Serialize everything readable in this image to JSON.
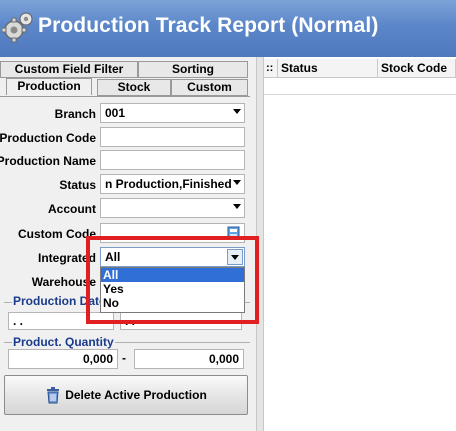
{
  "window": {
    "title": "Production Track Report (Normal)"
  },
  "tabs": {
    "row1": [
      "Custom Field Filter",
      "Sorting"
    ],
    "row2": [
      "Production",
      "Stock",
      "Custom"
    ]
  },
  "form": {
    "branch": {
      "label": "Branch",
      "value": "001"
    },
    "production_code": {
      "label": "Production Code",
      "value": ""
    },
    "production_name": {
      "label": "Production Name",
      "value": ""
    },
    "status": {
      "label": "Status",
      "value": "n Production,Finished"
    },
    "account": {
      "label": "Account",
      "value": ""
    },
    "custom_code": {
      "label": "Custom Code",
      "value": ""
    },
    "integrated": {
      "label": "Integrated",
      "value": "All"
    },
    "warehouse": {
      "label": "Warehouse",
      "value": ""
    }
  },
  "production_date": {
    "label": "Production Date",
    "from": ". .",
    "to": ". ."
  },
  "product_quantity": {
    "label": "Product. Quantity",
    "from": "0,000",
    "separator": "-",
    "to": "0,000"
  },
  "dropdown": {
    "options": [
      "All",
      "Yes",
      "No"
    ],
    "selected": "All"
  },
  "actions": {
    "delete_label": "Delete Active Production"
  },
  "grid": {
    "marker": "::",
    "columns": [
      "Status",
      "Stock Code"
    ]
  },
  "colors": {
    "title_bar": "#5b86c8",
    "highlight": "#e02020",
    "selection": "#2f6fd6",
    "group_label": "#1a3c8c"
  }
}
